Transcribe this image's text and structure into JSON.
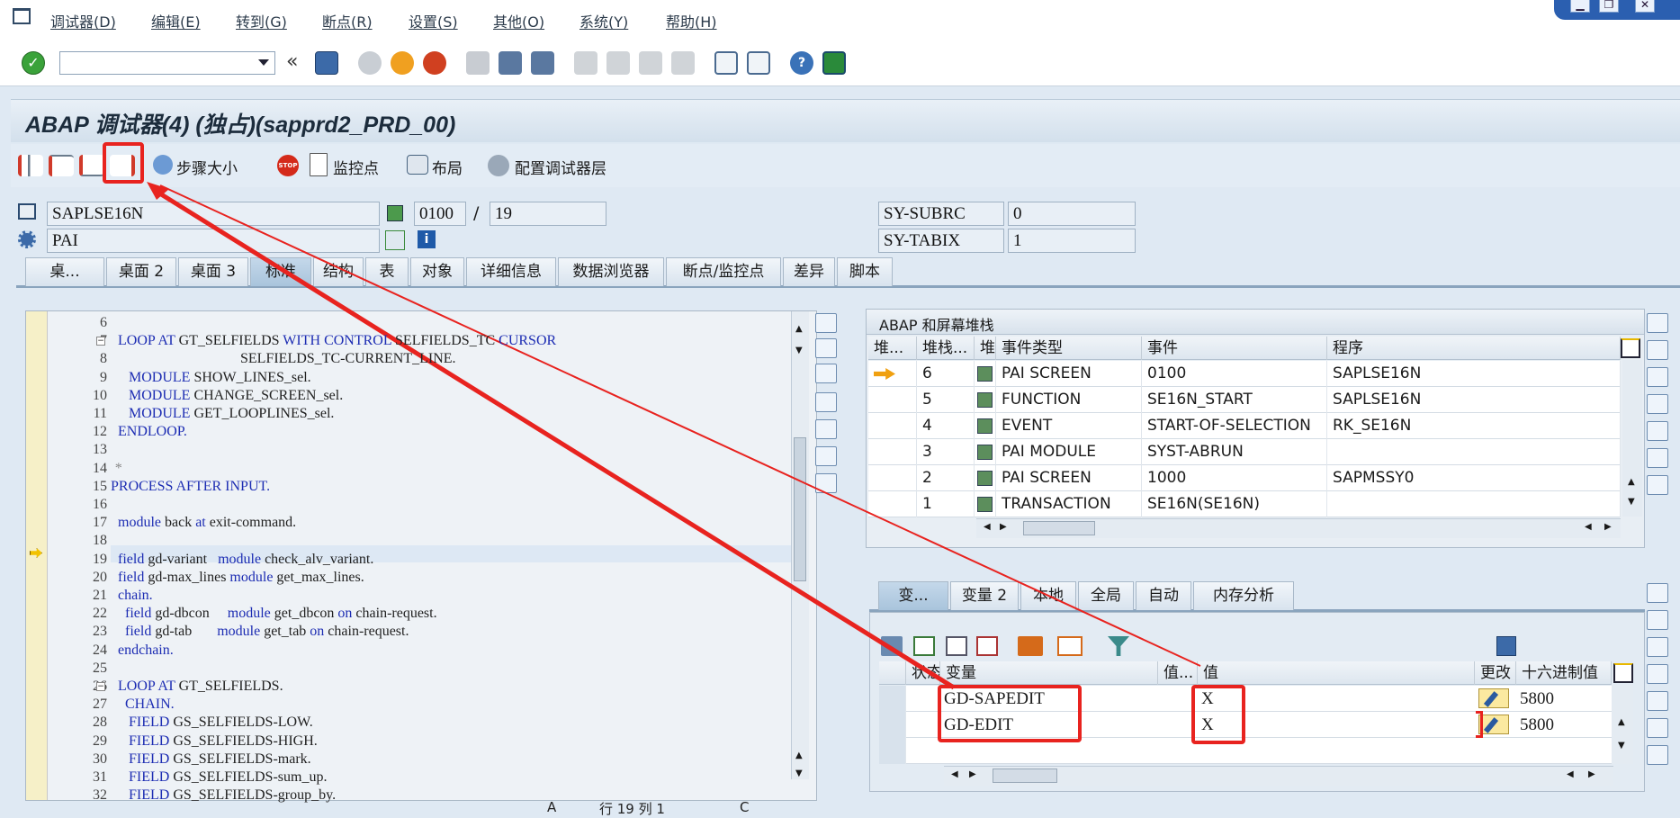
{
  "menu": [
    {
      "label": "调试器(D)"
    },
    {
      "label": "编辑(E)"
    },
    {
      "label": "转到(G)"
    },
    {
      "label": "断点(R)"
    },
    {
      "label": "设置(S)"
    },
    {
      "label": "其他(O)"
    },
    {
      "label": "系统(Y)"
    },
    {
      "label": "帮助(H)"
    }
  ],
  "window_controls": [
    "▁",
    "❐",
    "✕"
  ],
  "command_field": {
    "value": ""
  },
  "title": "ABAP 调试器(4)  (独占)(sapprd2_PRD_00)",
  "app_toolbar": {
    "step_size": "步骤大小",
    "watchpoint": "监控点",
    "layout": "布局",
    "config_layer": "配置调试器层"
  },
  "header_fields": {
    "program": "SAPLSE16N",
    "screen": "0100",
    "line": "19",
    "event": "PAI",
    "subrc_label": "SY-SUBRC",
    "subrc_value": "0",
    "tabix_label": "SY-TABIX",
    "tabix_value": "1",
    "slash": "/"
  },
  "main_tabs": [
    {
      "label": "桌..."
    },
    {
      "label": "桌面 2"
    },
    {
      "label": "桌面 3"
    },
    {
      "label": "标准"
    },
    {
      "label": "结构"
    },
    {
      "label": "表"
    },
    {
      "label": "对象"
    },
    {
      "label": "详细信息"
    },
    {
      "label": "数据浏览器"
    },
    {
      "label": "断点/监控点"
    },
    {
      "label": "差异"
    },
    {
      "label": "脚本"
    }
  ],
  "code_lines": [
    {
      "n": "6",
      "text": ""
    },
    {
      "n": "7",
      "text": "  LOOP AT GT_SELFIELDS WITH CONTROL SELFIELDS_TC CURSOR"
    },
    {
      "n": "8",
      "text": "                                    SELFIELDS_TC-CURRENT_LINE."
    },
    {
      "n": "9",
      "text": "     MODULE SHOW_LINES_sel."
    },
    {
      "n": "10",
      "text": "     MODULE CHANGE_SCREEN_sel."
    },
    {
      "n": "11",
      "text": "     MODULE GET_LOOPLINES_sel."
    },
    {
      "n": "12",
      "text": "  ENDLOOP."
    },
    {
      "n": "13",
      "text": ""
    },
    {
      "n": "14",
      "text": " *"
    },
    {
      "n": "15",
      "text": "PROCESS AFTER INPUT."
    },
    {
      "n": "16",
      "text": ""
    },
    {
      "n": "17",
      "text": "  module back at exit-command."
    },
    {
      "n": "18",
      "text": ""
    },
    {
      "n": "19",
      "text": "  field gd-variant   module check_alv_variant."
    },
    {
      "n": "20",
      "text": "  field gd-max_lines module get_max_lines."
    },
    {
      "n": "21",
      "text": "  chain."
    },
    {
      "n": "22",
      "text": "    field gd-dbcon     module get_dbcon on chain-request."
    },
    {
      "n": "23",
      "text": "    field gd-tab       module get_tab on chain-request."
    },
    {
      "n": "24",
      "text": "  endchain."
    },
    {
      "n": "25",
      "text": ""
    },
    {
      "n": "26",
      "text": "  LOOP AT GT_SELFIELDS."
    },
    {
      "n": "27",
      "text": "    CHAIN."
    },
    {
      "n": "28",
      "text": "     FIELD GS_SELFIELDS-LOW."
    },
    {
      "n": "29",
      "text": "     FIELD GS_SELFIELDS-HIGH."
    },
    {
      "n": "30",
      "text": "     FIELD GS_SELFIELDS-mark."
    },
    {
      "n": "31",
      "text": "     FIELD GS_SELFIELDS-sum_up."
    },
    {
      "n": "32",
      "text": "     FIELD GS_SELFIELDS-group_by."
    }
  ],
  "editor_status": {
    "mode": "A",
    "pos": "行 19 列 1",
    "c": "C"
  },
  "stack_panel": {
    "title": "ABAP 和屏幕堆栈",
    "columns": [
      "堆...",
      "堆栈...",
      "堆.",
      "事件类型",
      "事件",
      "程序"
    ],
    "rows": [
      {
        "level": "6",
        "type": "PAI SCREEN",
        "event": "0100",
        "program": "SAPLSE16N",
        "current": true
      },
      {
        "level": "5",
        "type": "FUNCTION",
        "event": "SE16N_START",
        "program": "SAPLSE16N"
      },
      {
        "level": "4",
        "type": "EVENT",
        "event": "START-OF-SELECTION",
        "program": "RK_SE16N"
      },
      {
        "level": "3",
        "type": "PAI MODULE",
        "event": "SYST-ABRUN",
        "program": ""
      },
      {
        "level": "2",
        "type": "PAI SCREEN",
        "event": "1000",
        "program": "SAPMSSY0"
      },
      {
        "level": "1",
        "type": "TRANSACTION",
        "event": "SE16N(SE16N)",
        "program": ""
      }
    ]
  },
  "var_tabs": [
    {
      "label": "变..."
    },
    {
      "label": "变量 2"
    },
    {
      "label": "本地"
    },
    {
      "label": "全局"
    },
    {
      "label": "自动"
    },
    {
      "label": "内存分析"
    }
  ],
  "var_panel": {
    "columns": [
      "状态",
      "变量",
      "值...",
      "值",
      "更改",
      "十六进制值"
    ],
    "rows": [
      {
        "variable": "GD-SAPEDIT",
        "value": "X",
        "hex": "5800"
      },
      {
        "variable": "GD-EDIT",
        "value": "X",
        "hex": "5800"
      }
    ]
  },
  "colors": {
    "annotation": "#e8231f",
    "keyword": "#1d2db3",
    "titlebar": "#d3e0ec"
  }
}
